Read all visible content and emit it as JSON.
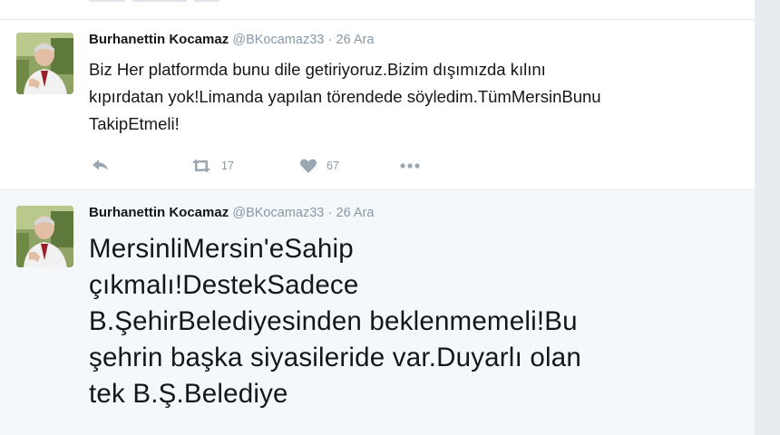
{
  "tweets": [
    {
      "author_name": "Burhanettin Kocamaz",
      "handle": "@BKocamaz33",
      "separator": "·",
      "date": "26 Ara",
      "text": "Biz Her platformda bunu dile getiriyoruz.Bizim dışımızda kılını\nkıpırdatan yok!Limanda yapılan törendede söyledim.TümMersinBunu\nTakipEtmeli!",
      "retweet_count": "17",
      "like_count": "67",
      "icons": [
        "reply-icon",
        "retweet-icon",
        "heart-icon",
        "more-icon"
      ]
    },
    {
      "author_name": "Burhanettin Kocamaz",
      "handle": "@BKocamaz33",
      "separator": "·",
      "date": "26 Ara",
      "text": "MersinliMersin'eSahip\nçıkmalı!DestekSadece\nB.ŞehirBelediyesinden beklenmemeli!Bu\nşehrin başka siyasileride var.Duyarlı olan\ntek B.Ş.Belediye"
    }
  ],
  "colors": {
    "name": "#14171a",
    "muted": "#8899a6",
    "border": "#e1e8ed",
    "page_bg": "#e6ecf0"
  }
}
